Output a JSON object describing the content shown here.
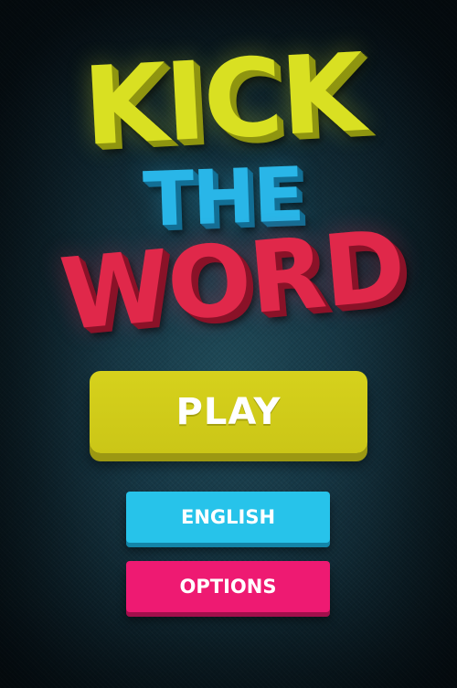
{
  "logo": {
    "line1": "KICK",
    "line2": "THE",
    "line3": "WORD",
    "colors": {
      "kick": "#d9e022",
      "kick_side": "#8f9510",
      "the": "#29b6e8",
      "the_side": "#136f95",
      "word": "#e0284a",
      "word_side": "#8a1228"
    }
  },
  "menu": {
    "play_label": "PLAY",
    "language_label": "ENGLISH",
    "options_label": "OPTIONS"
  },
  "colors": {
    "play": "#d6d11c",
    "play_side": "#9c9812",
    "language": "#27c3ea",
    "language_side": "#1385a8",
    "options": "#ee1a72",
    "options_side": "#a20f4c"
  }
}
